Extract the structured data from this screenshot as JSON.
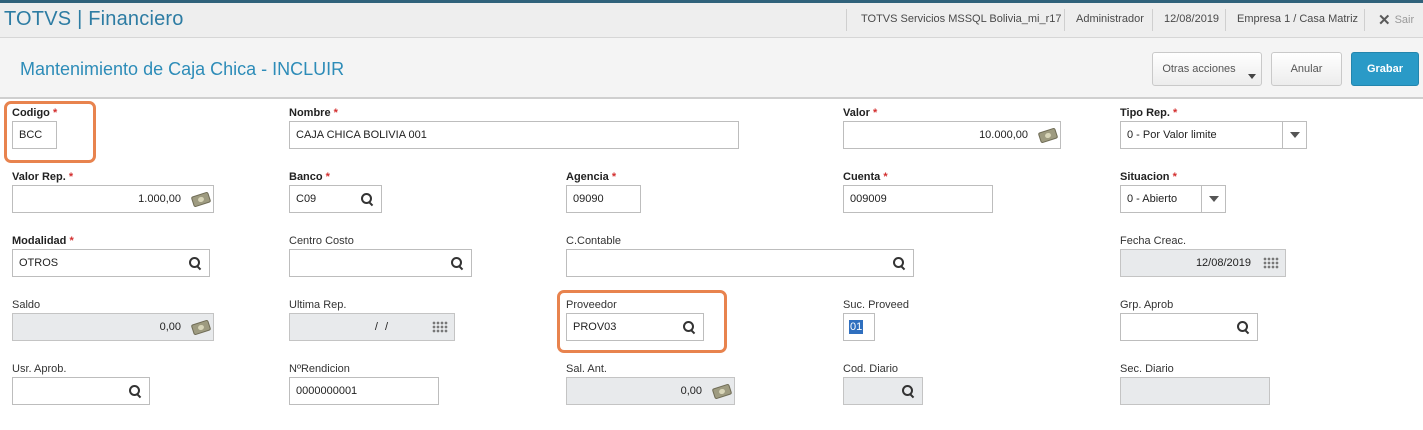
{
  "app": {
    "brand": "TOTVS | Financiero",
    "environment": "TOTVS Servicios MSSQL Bolivia_mi_r17",
    "user": "Administrador",
    "date": "12/08/2019",
    "company": "Empresa 1 / Casa Matriz",
    "exit_label": "Sair"
  },
  "header": {
    "title": "Mantenimiento de Caja Chica - INCLUIR",
    "otras_label": "Otras acciones",
    "anular_label": "Anular",
    "grabar_label": "Grabar"
  },
  "form": {
    "codigo": {
      "label": "Codigo",
      "value": "BCC"
    },
    "nombre": {
      "label": "Nombre",
      "value": "CAJA CHICA BOLIVIA 001"
    },
    "valor": {
      "label": "Valor",
      "value": "10.000,00"
    },
    "tipo_rep": {
      "label": "Tipo Rep.",
      "value": "0 - Por Valor limite"
    },
    "valor_rep": {
      "label": "Valor Rep.",
      "value": "1.000,00"
    },
    "banco": {
      "label": "Banco",
      "value": "C09"
    },
    "agencia": {
      "label": "Agencia",
      "value": "09090"
    },
    "cuenta": {
      "label": "Cuenta",
      "value": "009009"
    },
    "situacion": {
      "label": "Situacion",
      "value": "0 - Abierto"
    },
    "modalidad": {
      "label": "Modalidad",
      "value": "OTROS"
    },
    "centro_costo": {
      "label": "Centro Costo",
      "value": ""
    },
    "c_contable": {
      "label": "C.Contable",
      "value": ""
    },
    "fecha_creac": {
      "label": "Fecha Creac.",
      "value": "12/08/2019"
    },
    "saldo": {
      "label": "Saldo",
      "value": "0,00"
    },
    "ultima_rep": {
      "label": "Ultima Rep.",
      "value": "/ /"
    },
    "proveedor": {
      "label": "Proveedor",
      "value": "PROV03"
    },
    "suc_proveed": {
      "label": "Suc. Proveed",
      "value": "01"
    },
    "grp_aprob": {
      "label": "Grp. Aprob",
      "value": ""
    },
    "usr_aprob": {
      "label": "Usr. Aprob.",
      "value": ""
    },
    "nrendicion": {
      "label": "NºRendicion",
      "value": "0000000001"
    },
    "sal_ant": {
      "label": "Sal. Ant.",
      "value": "0,00"
    },
    "cod_diario": {
      "label": "Cod. Diario",
      "value": ""
    },
    "sec_diario": {
      "label": "Sec. Diario",
      "value": ""
    }
  },
  "colors": {
    "brand": "#2d7ca3",
    "title": "#2d8cb8",
    "primary_button": "#2a9ac7",
    "highlight": "#e8834e",
    "required_mark": "#d32f2f"
  }
}
